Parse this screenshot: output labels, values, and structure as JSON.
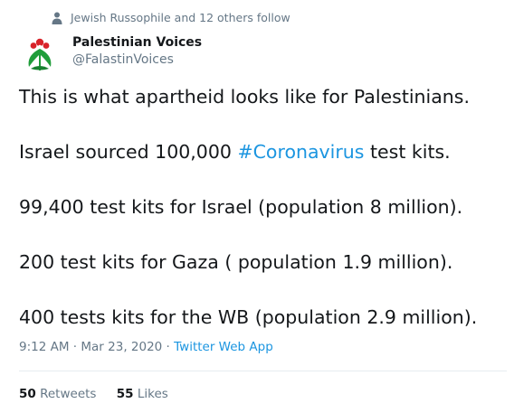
{
  "social_context": {
    "icon": "person-icon",
    "text": "Jewish Russophile and 12 others follow"
  },
  "author": {
    "avatar_icon": "palestinian-voices-logo",
    "display_name": "Palestinian Voices",
    "handle": "@FalastinVoices"
  },
  "tweet": {
    "line1": "This is what apartheid looks like for Palestinians.",
    "line2_before": "Israel sourced 100,000 ",
    "line2_hashtag": "#Coronavirus",
    "line2_after": " test kits.",
    "line3": "99,400 test kits for Israel (population 8 million).",
    "line4": "200 test kits for Gaza ( population 1.9 million).",
    "line5": "400 tests kits for the WB (population 2.9 million)."
  },
  "meta": {
    "time": "9:12 AM",
    "sep1": " · ",
    "date": "Mar 23, 2020",
    "sep2": " · ",
    "source": "Twitter Web App"
  },
  "stats": {
    "retweets_count": "50",
    "retweets_label": "Retweets",
    "likes_count": "55",
    "likes_label": "Likes"
  },
  "colors": {
    "link": "#1b95e0",
    "secondary_text": "#657786",
    "primary_text": "#14171a",
    "logo_red": "#d8232a",
    "logo_green": "#1f9d3a"
  }
}
